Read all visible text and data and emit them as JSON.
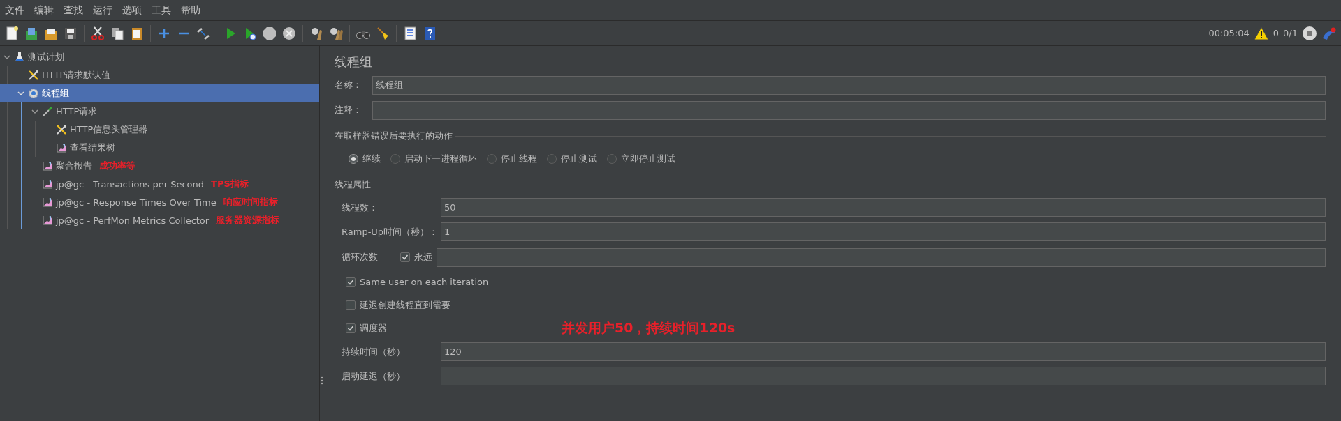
{
  "menu": [
    "文件",
    "编辑",
    "查找",
    "运行",
    "选项",
    "工具",
    "帮助"
  ],
  "status": {
    "timer": "00:05:04",
    "warnings": "0",
    "threads": "0/1"
  },
  "tree": [
    {
      "label": "测试计划",
      "kind": "plan",
      "expanded": true,
      "selected": false,
      "children": [
        {
          "label": "HTTP请求默认值",
          "kind": "config",
          "selected": false
        },
        {
          "label": "线程组",
          "kind": "thread-group",
          "expanded": true,
          "selected": true,
          "children": [
            {
              "label": "HTTP请求",
              "kind": "sampler",
              "expanded": true,
              "selected": false,
              "children": [
                {
                  "label": "HTTP信息头管理器",
                  "kind": "config",
                  "selected": false
                },
                {
                  "label": "查看结果树",
                  "kind": "listener",
                  "selected": false
                }
              ]
            },
            {
              "label": "聚合报告",
              "kind": "listener",
              "selected": false,
              "note": "成功率等"
            },
            {
              "label": "jp@gc - Transactions per Second",
              "kind": "listener",
              "selected": false,
              "note": "TPS指标"
            },
            {
              "label": "jp@gc - Response Times Over Time",
              "kind": "listener",
              "selected": false,
              "note": "响应时间指标"
            },
            {
              "label": "jp@gc - PerfMon Metrics Collector",
              "kind": "listener",
              "selected": false,
              "note": "服务器资源指标"
            }
          ]
        }
      ]
    }
  ],
  "panel": {
    "title": "线程组",
    "name_label": "名称：",
    "name_value": "线程组",
    "comment_label": "注释："
  },
  "error_action": {
    "legend": "在取样器错误后要执行的动作",
    "options": [
      {
        "label": "继续",
        "selected": true
      },
      {
        "label": "启动下一进程循环",
        "selected": false
      },
      {
        "label": "停止线程",
        "selected": false
      },
      {
        "label": "停止测试",
        "selected": false
      },
      {
        "label": "立即停止测试",
        "selected": false
      }
    ]
  },
  "thread_properties": {
    "legend": "线程属性",
    "items": [
      {
        "kind": "field",
        "label": "线程数：",
        "value": "50"
      },
      {
        "kind": "field",
        "label": "Ramp-Up时间（秒）：",
        "value": "1"
      },
      {
        "kind": "loop",
        "label": "循环次数",
        "check_label": "永远",
        "checked": true
      },
      {
        "kind": "checkbox",
        "label": "Same user on each iteration",
        "checked": true
      },
      {
        "kind": "checkbox",
        "label": "延迟创建线程直到需要",
        "checked": false
      },
      {
        "kind": "checkbox",
        "label": "调度器",
        "checked": true,
        "note": "并发用户50，持续时间120s"
      },
      {
        "kind": "field",
        "label": "持续时间（秒）",
        "value": "120"
      },
      {
        "kind": "field",
        "label": "启动延迟（秒）"
      }
    ]
  }
}
